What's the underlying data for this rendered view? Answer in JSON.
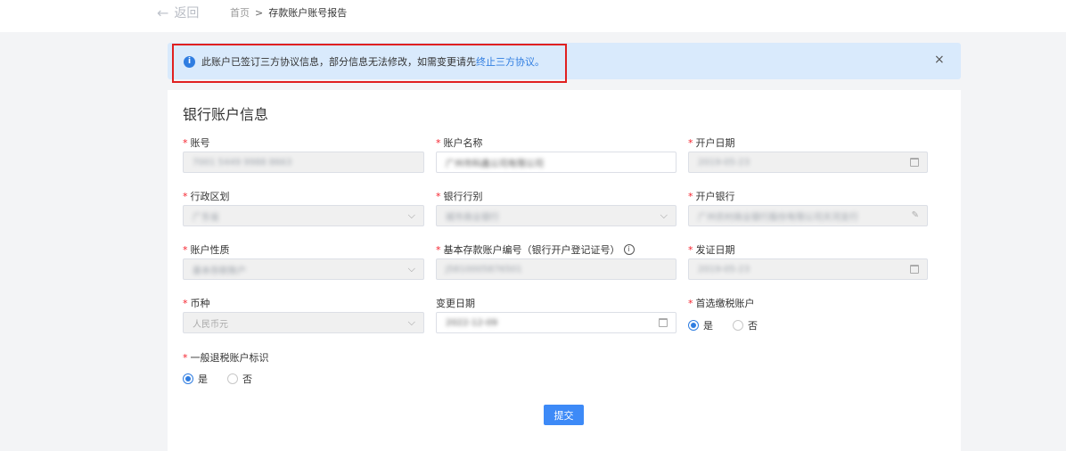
{
  "topbar": {
    "back_label": "返回",
    "breadcrumb": [
      "首页",
      "存款账户账号报告"
    ],
    "separator": ">"
  },
  "alert": {
    "message": "此账户已签订三方协议信息，部分信息无法修改，如需变更请先",
    "link_text": "终止三方协议",
    "suffix": "。",
    "close": "×"
  },
  "form": {
    "title": "银行账户信息",
    "fields": {
      "account_no": {
        "label": "账号",
        "value": "7001 5449 9988 8663",
        "required": true
      },
      "account_name": {
        "label": "账户名称",
        "value": "广州市科鑫公司有限公司",
        "required": true
      },
      "open_date": {
        "label": "开户日期",
        "value": "2019-05-23",
        "required": true
      },
      "district": {
        "label": "行政区划",
        "value": "广东省",
        "required": true
      },
      "bank_type": {
        "label": "银行行别",
        "value": "城市商业银行",
        "required": true
      },
      "open_bank": {
        "label": "开户银行",
        "value": "广州农村商业银行股份有限公司天河支行",
        "required": true
      },
      "account_nature": {
        "label": "账户性质",
        "value": "基本存款账户",
        "required": true
      },
      "basic_account_no": {
        "label": "基本存款账户编号（银行开户登记证号）",
        "value": "J5810005876501",
        "required": true
      },
      "issue_date": {
        "label": "发证日期",
        "value": "2019-05-23",
        "required": true
      },
      "currency": {
        "label": "币种",
        "value": "人民币元",
        "required": true
      },
      "change_date": {
        "label": "变更日期",
        "value": "2022-12-09",
        "required": false
      },
      "preferred_tax": {
        "label": "首选缴税账户",
        "required": true,
        "options": [
          "是",
          "否"
        ],
        "selected": "是"
      },
      "refund_flag": {
        "label": "一般退税账户标识",
        "required": true,
        "options": [
          "是",
          "否"
        ],
        "selected": "是"
      }
    },
    "submit_label": "提交"
  },
  "colors": {
    "primary": "#2f7de1",
    "required": "#f5222d",
    "alert_bg": "#d9eafc",
    "highlight": "#e02020"
  },
  "icons": {
    "back": "arrow-left-icon",
    "info": "info-icon",
    "close": "close-icon",
    "calendar": "calendar-icon",
    "chevron": "chevron-down-icon",
    "help": "help-circle-icon"
  }
}
